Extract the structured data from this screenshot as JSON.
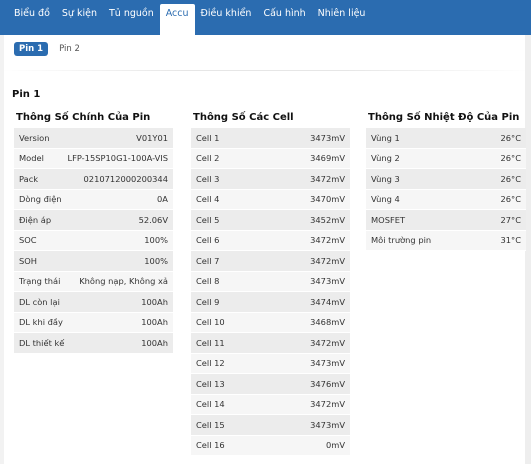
{
  "nav": {
    "tabs": [
      "Biểu đồ",
      "Sự kiện",
      "Tủ nguồn",
      "Accu",
      "Điều khiển",
      "Cấu hình",
      "Nhiên liệu"
    ],
    "active_tab": "Accu"
  },
  "subtabs": {
    "items": [
      "Pin 1",
      "Pin 2"
    ],
    "active": "Pin 1"
  },
  "section_title": "Pin 1",
  "main_params": {
    "title": "Thông Số Chính Của Pin",
    "rows": [
      {
        "label": "Version",
        "value": "V01Y01"
      },
      {
        "label": "Model",
        "value": "LFP-15SP10G1-100A-VIS"
      },
      {
        "label": "Pack",
        "value": "0210712000200344"
      },
      {
        "label": "Dòng điện",
        "value": "0A"
      },
      {
        "label": "Điện áp",
        "value": "52.06V"
      },
      {
        "label": "SOC",
        "value": "100%"
      },
      {
        "label": "SOH",
        "value": "100%"
      },
      {
        "label": "Trạng thái",
        "value": "Không nạp, Không xả"
      },
      {
        "label": "DL còn lại",
        "value": "100Ah"
      },
      {
        "label": "DL khi đầy",
        "value": "100Ah"
      },
      {
        "label": "DL thiết kế",
        "value": "100Ah"
      }
    ]
  },
  "cell_params": {
    "title": "Thông Số Các Cell",
    "rows": [
      {
        "label": "Cell 1",
        "value": "3473mV"
      },
      {
        "label": "Cell 2",
        "value": "3469mV"
      },
      {
        "label": "Cell 3",
        "value": "3472mV"
      },
      {
        "label": "Cell 4",
        "value": "3470mV"
      },
      {
        "label": "Cell 5",
        "value": "3452mV"
      },
      {
        "label": "Cell 6",
        "value": "3472mV"
      },
      {
        "label": "Cell 7",
        "value": "3472mV"
      },
      {
        "label": "Cell 8",
        "value": "3473mV"
      },
      {
        "label": "Cell 9",
        "value": "3474mV"
      },
      {
        "label": "Cell 10",
        "value": "3468mV"
      },
      {
        "label": "Cell 11",
        "value": "3472mV"
      },
      {
        "label": "Cell 12",
        "value": "3473mV"
      },
      {
        "label": "Cell 13",
        "value": "3476mV"
      },
      {
        "label": "Cell 14",
        "value": "3472mV"
      },
      {
        "label": "Cell 15",
        "value": "3473mV"
      },
      {
        "label": "Cell 16",
        "value": "0mV"
      }
    ]
  },
  "temp_params": {
    "title": "Thông Số Nhiệt Độ Của Pin",
    "rows": [
      {
        "label": "Vùng 1",
        "value": "26°C"
      },
      {
        "label": "Vùng 2",
        "value": "26°C"
      },
      {
        "label": "Vùng 3",
        "value": "26°C"
      },
      {
        "label": "Vùng 4",
        "value": "26°C"
      },
      {
        "label": "MOSFET",
        "value": "27°C"
      },
      {
        "label": "Môi trường pin",
        "value": "31°C"
      }
    ]
  }
}
